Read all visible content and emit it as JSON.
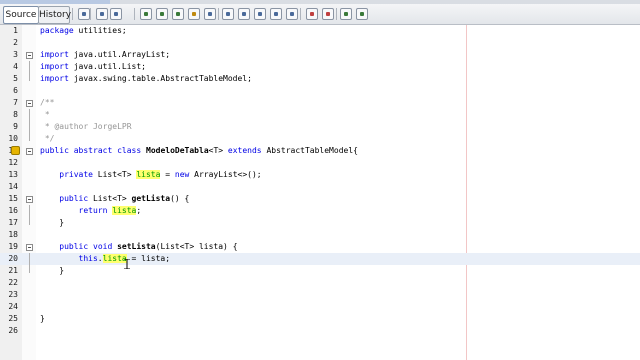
{
  "toolbar": {
    "tabs": [
      {
        "label": "Source",
        "active": true
      },
      {
        "label": "History",
        "active": false
      }
    ],
    "buttons": [
      {
        "name": "last-edit-icon",
        "color": "#4a6a9a"
      },
      {
        "name": "back-icon",
        "color": "#4a6a9a"
      },
      {
        "name": "forward-icon",
        "color": "#4a6a9a"
      },
      {
        "name": "find-icon",
        "color": "#3a7a3a"
      },
      {
        "name": "find-previous-icon",
        "color": "#3a7a3a"
      },
      {
        "name": "find-next-icon",
        "color": "#3a7a3a"
      },
      {
        "name": "highlight-icon",
        "color": "#c08a10"
      },
      {
        "name": "toggle-selection-icon",
        "color": "#4a6a9a"
      },
      {
        "name": "previous-bookmark-icon",
        "color": "#4a6a9a"
      },
      {
        "name": "next-bookmark-icon",
        "color": "#4a6a9a"
      },
      {
        "name": "toggle-bookmark-icon",
        "color": "#4a6a9a"
      },
      {
        "name": "shift-left-icon",
        "color": "#4a6a9a"
      },
      {
        "name": "shift-right-icon",
        "color": "#4a6a9a"
      },
      {
        "name": "start-macro-icon",
        "color": "#c04040"
      },
      {
        "name": "stop-macro-icon",
        "color": "#c04040"
      },
      {
        "name": "comment-icon",
        "color": "#3a7a3a"
      },
      {
        "name": "uncomment-icon",
        "color": "#3a7a3a"
      }
    ]
  },
  "editor": {
    "current_line": 20,
    "lines": [
      {
        "n": "1",
        "code": "package utilities;"
      },
      {
        "n": "2",
        "code": ""
      },
      {
        "n": "3",
        "code": "import java.util.ArrayList;"
      },
      {
        "n": "4",
        "code": "import java.util.List;"
      },
      {
        "n": "5",
        "code": "import javax.swing.table.AbstractTableModel;"
      },
      {
        "n": "6",
        "code": ""
      },
      {
        "n": "7",
        "code": "/**"
      },
      {
        "n": "8",
        "code": " *"
      },
      {
        "n": "9",
        "code": " * @author JorgeLPR"
      },
      {
        "n": "10",
        "code": " */"
      },
      {
        "n": "11",
        "code": "public abstract class ModeloDeTabla<T> extends AbstractTableModel{"
      },
      {
        "n": "12",
        "code": ""
      },
      {
        "n": "13",
        "code": "    private List<T> lista = new ArrayList<>();"
      },
      {
        "n": "14",
        "code": ""
      },
      {
        "n": "15",
        "code": "    public List<T> getLista() {"
      },
      {
        "n": "16",
        "code": "        return lista;"
      },
      {
        "n": "17",
        "code": "    }"
      },
      {
        "n": "18",
        "code": ""
      },
      {
        "n": "19",
        "code": "    public void setLista(List<T> lista) {"
      },
      {
        "n": "20",
        "code": "        this.lista = lista;"
      },
      {
        "n": "21",
        "code": "    }"
      },
      {
        "n": "22",
        "code": ""
      },
      {
        "n": "23",
        "code": ""
      },
      {
        "n": "24",
        "code": ""
      },
      {
        "n": "25",
        "code": "}"
      },
      {
        "n": "26",
        "code": ""
      }
    ]
  }
}
